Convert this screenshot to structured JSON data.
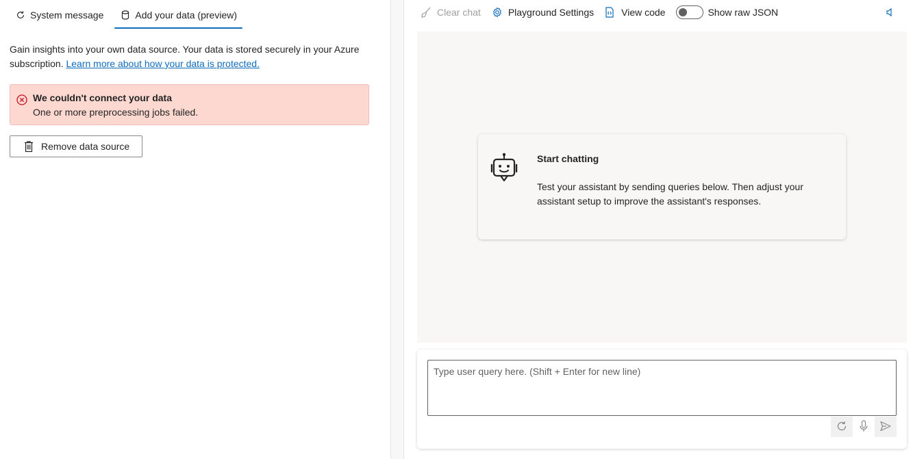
{
  "tabs": [
    {
      "label": "System message",
      "icon": "refresh-icon",
      "active": false
    },
    {
      "label": "Add your data (preview)",
      "icon": "database-icon",
      "active": true
    }
  ],
  "description": {
    "text": "Gain insights into your own data source. Your data is stored securely in your Azure subscription. ",
    "link": "Learn more about how your data is protected."
  },
  "error": {
    "title": "We couldn't connect your data",
    "message": "One or more preprocessing jobs failed.",
    "icon": "error-circle-icon"
  },
  "remove_button": {
    "label": "Remove data source",
    "icon": "trash-icon"
  },
  "toolbar": {
    "clear_chat": "Clear chat",
    "settings": "Playground Settings",
    "view_code": "View code",
    "show_raw_json": "Show raw JSON",
    "raw_json_enabled": false
  },
  "start_card": {
    "title": "Start chatting",
    "text": "Test your assistant by sending queries below. Then adjust your assistant setup to improve the assistant's responses.",
    "icon": "bot-icon"
  },
  "input": {
    "placeholder": "Type user query here. (Shift + Enter for new line)",
    "value": ""
  },
  "colors": {
    "accent": "#0f6cbd",
    "error_bg": "#fdd8d1",
    "error_icon": "#c50f1f",
    "chat_bg": "#f8f7f6"
  }
}
